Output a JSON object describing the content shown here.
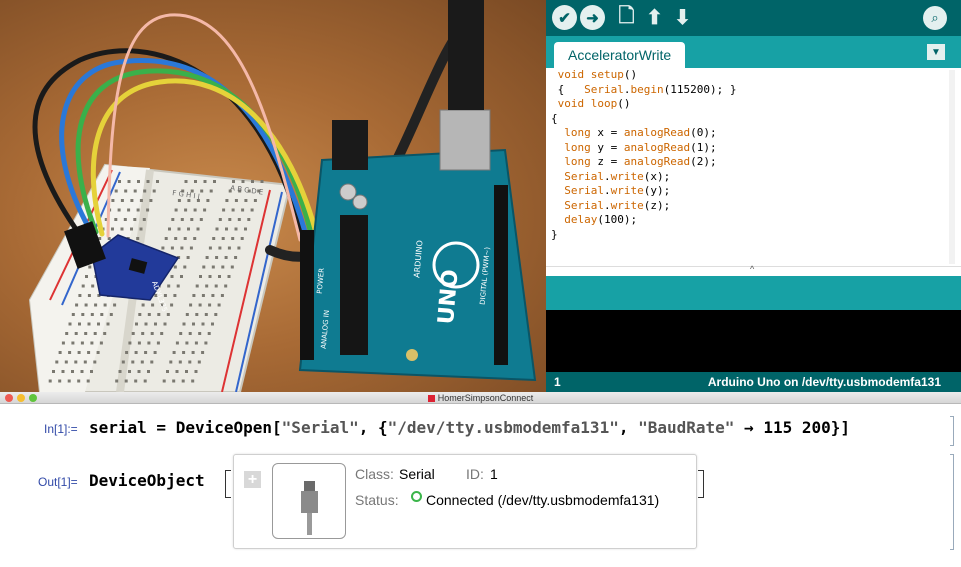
{
  "ide": {
    "toolbar": {
      "verify_icon": "check-icon",
      "upload_icon": "arrow-right-icon",
      "new_icon": "document-icon",
      "open_icon": "arrow-up-icon",
      "save_icon": "arrow-down-icon",
      "serial_monitor_icon": "magnifier-icon"
    },
    "tab_label": "AcceleratorWrite",
    "code_lines": [
      " void setup()",
      " {   Serial.begin(115200); }",
      " void loop()",
      "{",
      "  long x = analogRead(0);",
      "  long y = analogRead(1);",
      "  long z = analogRead(2);",
      "  Serial.write(x);",
      "  Serial.write(y);",
      "  Serial.write(z);",
      "  delay(100);",
      "}"
    ],
    "status_line": "1",
    "status_board": "Arduino Uno on /dev/tty.usbmodemfa131",
    "colors": {
      "toolbar": "#006468",
      "tabbar": "#17a1a5",
      "console": "#000000"
    }
  },
  "photo": {
    "board_text": "UNO",
    "board_brand": "ARDUINO",
    "board_digital": "DIGITAL (PWM~)",
    "board_power": "POWER",
    "board_analog": "ANALOG IN",
    "sensor_label": "ADXL335",
    "breadboard_letters_top": "F G H I J",
    "breadboard_letters_bottom": "A B C D E"
  },
  "notebook": {
    "window_title": "HomerSimpsonConnect",
    "in_label": "In[1]:=",
    "in_var": "serial",
    "in_eq": " = ",
    "in_fn": "DeviceOpen",
    "in_open": "[",
    "in_arg1": "\"Serial\"",
    "in_sep": ", {",
    "in_arg2": "\"/dev/tty.usbmodemfa131\"",
    "in_sep2": ", ",
    "in_arg3": "\"BaudRate\"",
    "in_arrow": " → ",
    "in_arg4": "115 200",
    "in_close": "}]",
    "out_label": "Out[1]=",
    "out_head": "DeviceObject",
    "device": {
      "class_label": "Class:",
      "class_value": "Serial",
      "id_label": "ID:",
      "id_value": "1",
      "status_label": "Status:",
      "status_value": "Connected (/dev/tty.usbmodemfa131)",
      "status_color": "#3bb54a"
    }
  }
}
